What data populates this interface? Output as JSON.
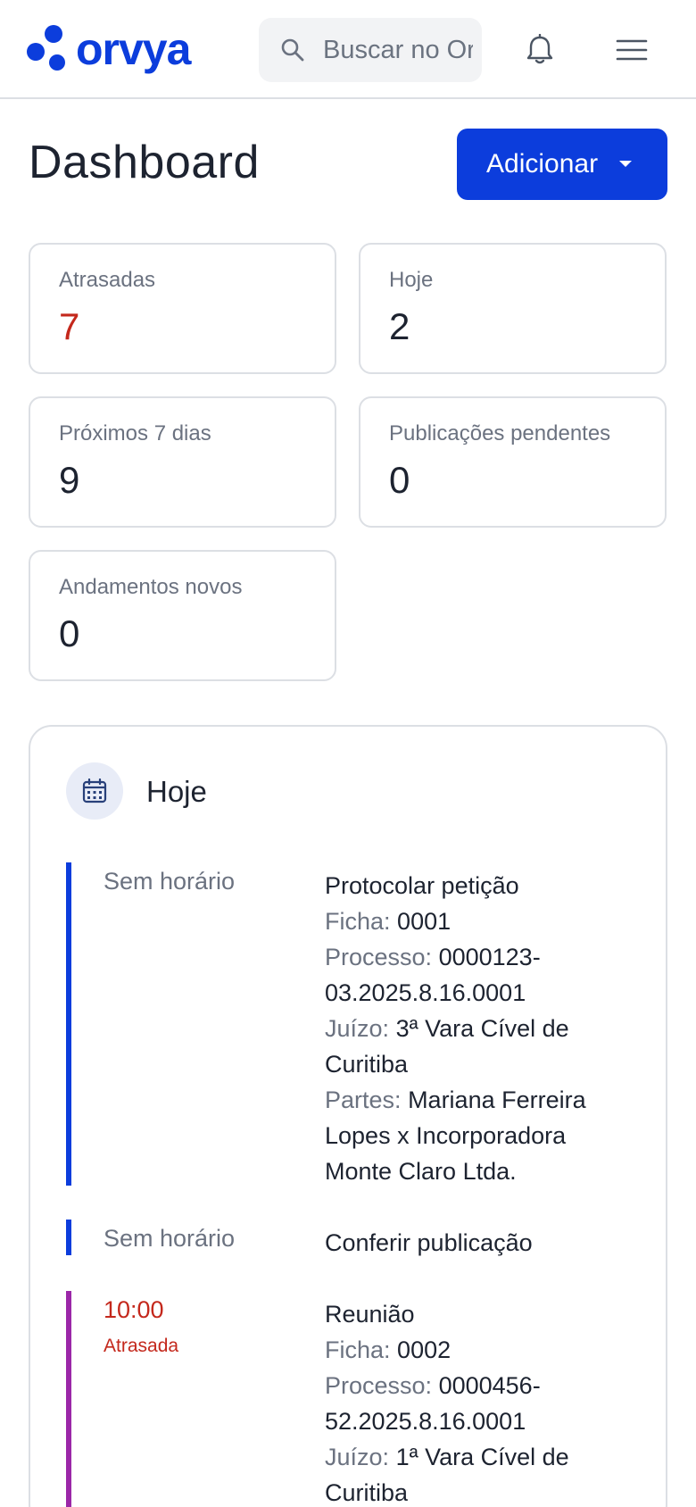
{
  "header": {
    "logo_text": "orvya",
    "search_placeholder": "Buscar no Orvya",
    "notifications_icon": "bell-icon",
    "menu_icon": "hamburger-menu-icon"
  },
  "page": {
    "title": "Dashboard",
    "add_button_label": "Adicionar"
  },
  "stats": [
    {
      "label": "Atrasadas",
      "value": "7",
      "color": "#c4281c"
    },
    {
      "label": "Hoje",
      "value": "2"
    },
    {
      "label": "Próximos 7 dias",
      "value": "9"
    },
    {
      "label": "Publicações pendentes",
      "value": "0"
    },
    {
      "label": "Andamentos novos",
      "value": "0"
    }
  ],
  "today": {
    "title": "Hoje",
    "icon": "calendar-icon",
    "items": [
      {
        "time": "Sem horário",
        "title": "Protocolar petição",
        "bar_color": "#0c3ddc",
        "ficha_label": "Ficha:",
        "ficha": "0001",
        "processo_label": "Processo:",
        "processo": "0000123-03.2025.8.16.0001",
        "juizo_label": "Juízo:",
        "juizo": "3ª Vara Cível de Curitiba",
        "partes_label": "Partes:",
        "partes": "Mariana Ferreira Lopes x Incorporadora Monte Claro Ltda."
      },
      {
        "time": "Sem horário",
        "title": "Conferir publicação",
        "bar_color": "#0c3ddc"
      },
      {
        "time": "10:00",
        "status": "Atrasada",
        "title": "Reunião",
        "bar_color": "#9b27a8",
        "ficha_label": "Ficha:",
        "ficha": "0002",
        "processo_label": "Processo:",
        "processo": "0000456-52.2025.8.16.0001",
        "juizo_label": "Juízo:",
        "juizo": "1ª Vara Cível de Curitiba"
      }
    ]
  },
  "colors": {
    "accent": "#0c3ddc",
    "danger": "#c4281c",
    "purple": "#9b27a8"
  }
}
